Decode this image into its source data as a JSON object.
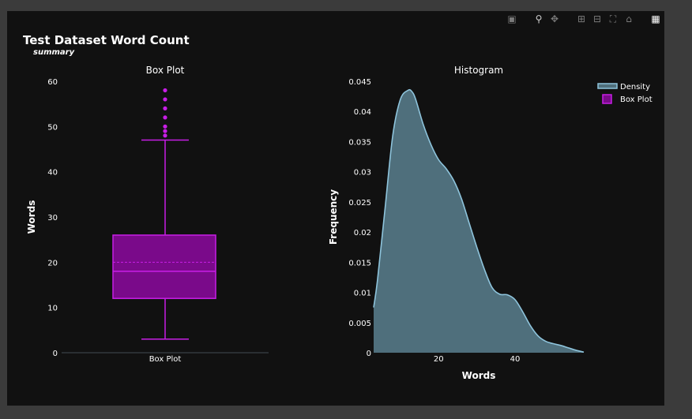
{
  "figure": {
    "title": "Test Dataset Word Count",
    "subtitle": "summary"
  },
  "colors": {
    "background": "#111111",
    "box_fill": "#7a0a8a",
    "box_line": "#c81ee6",
    "density_fill": "#4f6f7c",
    "density_line": "#8ec4dc",
    "text": "#ffffff"
  },
  "modebar": [
    "camera-icon",
    "zoom-icon",
    "pan-icon",
    "zoom-in-icon",
    "zoom-out-icon",
    "autoscale-icon",
    "home-icon",
    "plotly-logo-icon"
  ],
  "chart_data": [
    {
      "type": "box",
      "title": "Box Plot",
      "xlabel": "",
      "ylabel": "Words",
      "categories": [
        "Box Plot"
      ],
      "ylim": [
        0,
        60
      ],
      "yticks": [
        0,
        10,
        20,
        30,
        40,
        50,
        60
      ],
      "box": {
        "lower_fence": 3,
        "q1": 12,
        "median": 18,
        "mean": 20,
        "q3": 26,
        "upper_fence": 47
      },
      "outliers": [
        48,
        49,
        50,
        52,
        54,
        56,
        58
      ]
    },
    {
      "type": "area",
      "title": "Histogram",
      "xlabel": "Words",
      "ylabel": "Frequency",
      "xlim": [
        3,
        58
      ],
      "ylim": [
        0,
        0.045
      ],
      "xticks": [
        20,
        40
      ],
      "yticks": [
        0,
        0.005,
        0.01,
        0.015,
        0.02,
        0.025,
        0.03,
        0.035,
        0.04,
        0.045
      ],
      "series": [
        {
          "name": "Density",
          "x": [
            3,
            4,
            6,
            8,
            10,
            12,
            13,
            14,
            16,
            18,
            20,
            22,
            24,
            26,
            28,
            30,
            32,
            34,
            36,
            38,
            40,
            42,
            44,
            46,
            48,
            50,
            52,
            54,
            56,
            58
          ],
          "y": [
            0.0075,
            0.012,
            0.024,
            0.036,
            0.042,
            0.0435,
            0.0433,
            0.042,
            0.0378,
            0.0345,
            0.032,
            0.0305,
            0.0285,
            0.0255,
            0.0215,
            0.0175,
            0.0138,
            0.0108,
            0.0097,
            0.0096,
            0.0088,
            0.0068,
            0.0045,
            0.0028,
            0.0019,
            0.0015,
            0.0012,
            0.0008,
            0.0004,
            0.0001
          ]
        }
      ]
    }
  ],
  "legend": {
    "position": "top-right",
    "items": [
      {
        "label": "Density",
        "symbol": "line-fill"
      },
      {
        "label": "Box Plot",
        "symbol": "box"
      }
    ]
  }
}
